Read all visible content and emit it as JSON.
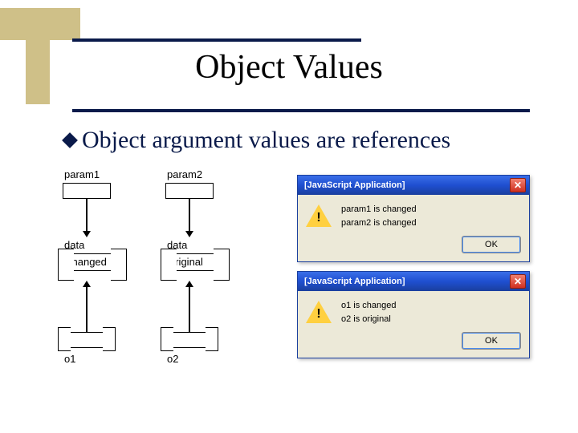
{
  "slide": {
    "title": "Object Values",
    "bullet": "Object argument values are references"
  },
  "diagram": {
    "param1": "param1",
    "param2": "param2",
    "data1_label": "data",
    "data2_label": "data",
    "data1_value": "changed",
    "data2_value": "original",
    "o1": "o1",
    "o2": "o2"
  },
  "dialog1": {
    "title": "[JavaScript Application]",
    "line1": "param1 is changed",
    "line2": "param2 is changed",
    "ok": "OK"
  },
  "dialog2": {
    "title": "[JavaScript Application]",
    "line1": "o1 is changed",
    "line2": "o2 is original",
    "ok": "OK"
  }
}
